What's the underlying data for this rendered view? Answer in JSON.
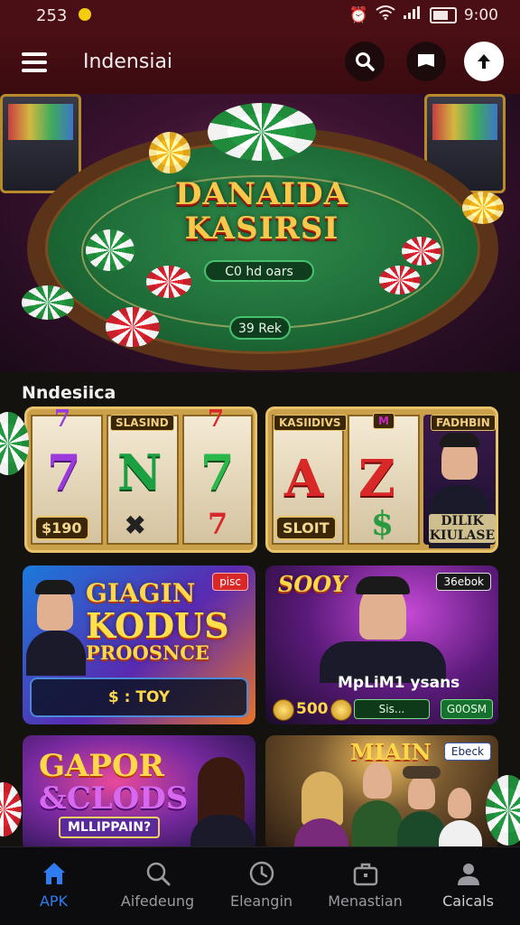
{
  "status_bar": {
    "time_left": "253",
    "time_right": "9:00"
  },
  "app_bar": {
    "title": "Indensiai"
  },
  "hero": {
    "title_line1": "DANAIDA",
    "title_line2": "KASIRSI",
    "pill_text": "C0 hd oars",
    "pill2_text": "39 Rek"
  },
  "section": {
    "title": "Nndesiica"
  },
  "slot_cards": [
    {
      "tag": "SLASIND",
      "bottom_tag": "$190"
    },
    {
      "tag": "KASIIDIVS",
      "top_right_tag": "FADHBIN",
      "bottom_left_tag": "SLOIT",
      "person_caption": "DILIK KIULASE"
    }
  ],
  "promo_cards": [
    {
      "headline_line1": "GIAGIN",
      "headline_line2": "KODUS",
      "headline_line3": "PROOSNCE",
      "badge": "pisc",
      "footer": "$ : TOY"
    },
    {
      "headline": "SOOY",
      "badge": "36ebok",
      "caption": "MpLiM1 ysans",
      "amount": "500",
      "button_left": "Sis...",
      "button_right": "G0OSM"
    }
  ],
  "bottom_cards": [
    {
      "headline_line1": "GAPOR",
      "headline_line2": "&CLODS",
      "subtitle": "MLLIPPAIN?"
    },
    {
      "headline": "MIAIN",
      "badge": "Ebeck"
    }
  ],
  "nav": [
    {
      "label": "APK",
      "icon": "home-icon",
      "active": true
    },
    {
      "label": "Aifedeung",
      "icon": "search-icon",
      "active": false
    },
    {
      "label": "Eleangin",
      "icon": "clock-icon",
      "active": false
    },
    {
      "label": "Menastian",
      "icon": "briefcase-icon",
      "active": false
    },
    {
      "label": "Caicals",
      "icon": "person-icon",
      "active": false
    }
  ],
  "colors": {
    "accent": "#2f7cf0",
    "appbar": "#4a0f14",
    "background": "#14120f"
  }
}
